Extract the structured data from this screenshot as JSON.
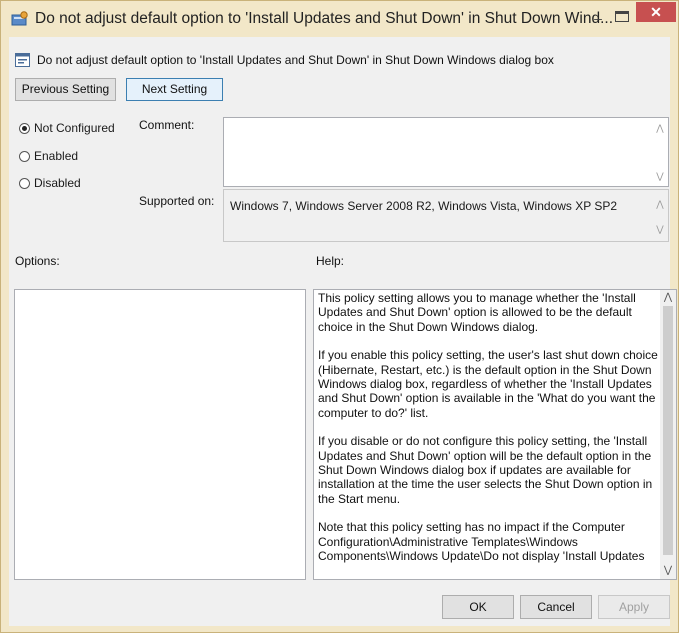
{
  "window": {
    "title": "Do not adjust default option to 'Install Updates and Shut Down' in Shut Down Wind...",
    "min_glyph": "–",
    "close_glyph": "✕",
    "accent_close": "#c75050"
  },
  "header": {
    "text": "Do not adjust default option to 'Install Updates and Shut Down' in Shut Down Windows dialog box"
  },
  "nav": {
    "previous_label": "Previous Setting",
    "next_label": "Next Setting"
  },
  "state": {
    "options": [
      {
        "label": "Not Configured",
        "selected": true
      },
      {
        "label": "Enabled",
        "selected": false
      },
      {
        "label": "Disabled",
        "selected": false
      }
    ]
  },
  "comment": {
    "label": "Comment:",
    "value": ""
  },
  "supported": {
    "label": "Supported on:",
    "value": "Windows 7, Windows Server 2008 R2, Windows Vista, Windows XP SP2"
  },
  "options_panel": {
    "label": "Options:"
  },
  "help_panel": {
    "label": "Help:",
    "paragraphs": [
      "This policy setting allows you to manage whether the 'Install Updates and Shut Down' option is allowed to be the default choice in the Shut Down Windows dialog.",
      "If you enable this policy setting, the user's last shut down choice (Hibernate, Restart, etc.) is the default option in the Shut Down Windows dialog box, regardless of whether the 'Install Updates and Shut Down' option is available in the 'What do you want the computer to do?' list.",
      "If you disable or do not configure this policy setting, the 'Install Updates and Shut Down' option will be the default option in the Shut Down Windows dialog box if updates are available for installation at the time the user selects the Shut Down option in the Start menu.",
      "Note that this policy setting has no impact if the Computer Configuration\\Administrative Templates\\Windows Components\\Windows Update\\Do not display 'Install Updates"
    ]
  },
  "footer": {
    "ok_label": "OK",
    "cancel_label": "Cancel",
    "apply_label": "Apply"
  }
}
